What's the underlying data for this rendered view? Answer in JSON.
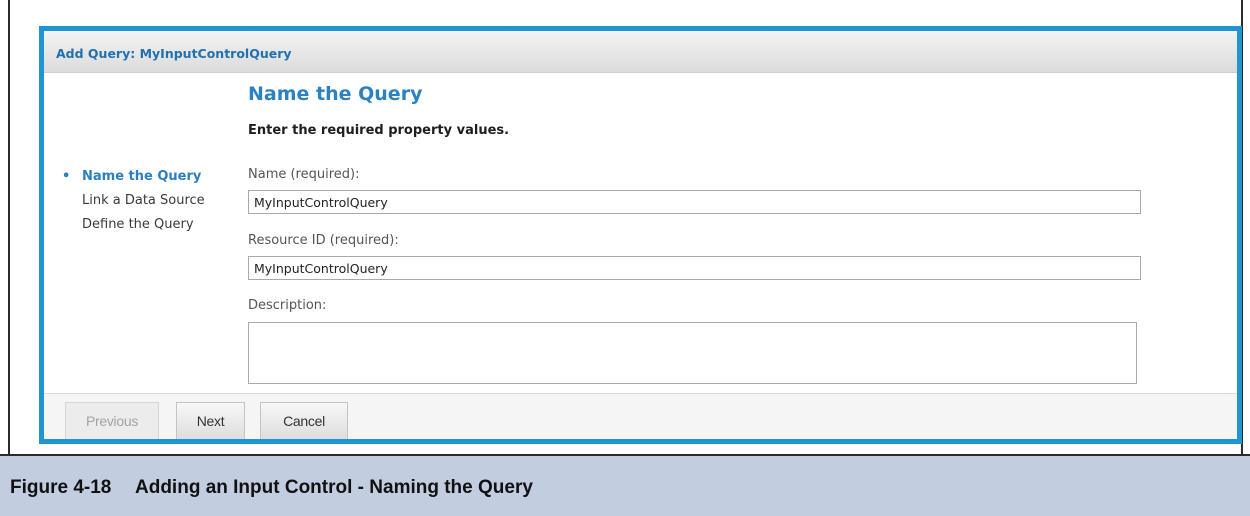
{
  "dialog": {
    "title": "Add Query: MyInputControlQuery",
    "heading": "Name the Query",
    "instruction": "Enter the required property values."
  },
  "nav": {
    "bullet": "•",
    "items": [
      {
        "label": "Name the Query",
        "active": true
      },
      {
        "label": "Link a Data Source",
        "active": false
      },
      {
        "label": "Define the Query",
        "active": false
      }
    ]
  },
  "form": {
    "name_label": "Name (required):",
    "name_value": "MyInputControlQuery",
    "resource_id_label": "Resource ID (required):",
    "resource_id_value": "MyInputControlQuery",
    "description_label": "Description:",
    "description_value": ""
  },
  "buttons": {
    "previous": "Previous",
    "next": "Next",
    "cancel": "Cancel"
  },
  "caption": {
    "number": "Figure 4-18",
    "text": "Adding an Input Control - Naming the Query"
  },
  "colors": {
    "dialog_border": "#1f96d1",
    "accent": "#2b82c2",
    "caption_bg": "#c2cee0"
  }
}
